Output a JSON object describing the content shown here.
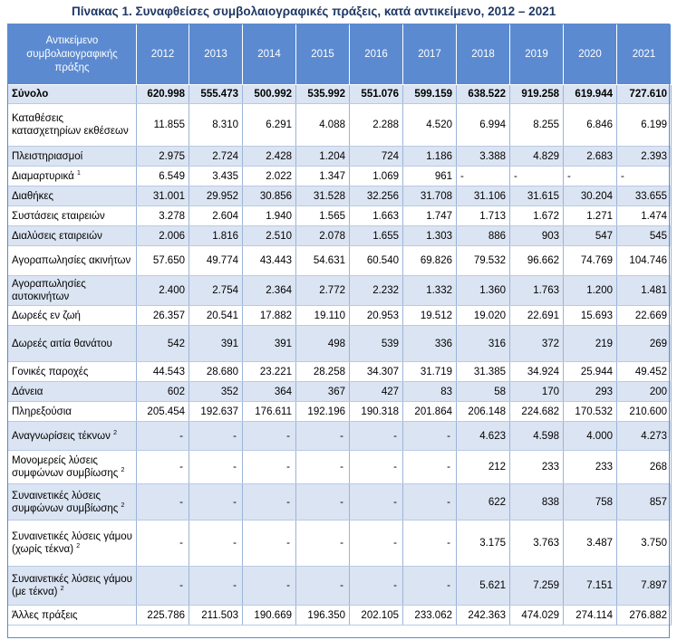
{
  "title": "Πίνακας 1. Συναφθείσες συμβολαιογραφικές πράξεις, κατά αντικείμενο, 2012 – 2021",
  "header": {
    "category": "Αντικείμενο συμβολαιογραφικής πράξης",
    "years": [
      "2012",
      "2013",
      "2014",
      "2015",
      "2016",
      "2017",
      "2018",
      "2019",
      "2020",
      "2021"
    ]
  },
  "rows": [
    {
      "label": "Σύνολο",
      "sup": "",
      "values": [
        "620.998",
        "555.473",
        "500.992",
        "535.992",
        "551.076",
        "599.159",
        "638.522",
        "919.258",
        "619.944",
        "727.610"
      ]
    },
    {
      "label": "Καταθέσεις κατασχετηρίων εκθέσεων",
      "sup": "",
      "values": [
        "11.855",
        "8.310",
        "6.291",
        "4.088",
        "2.288",
        "4.520",
        "6.994",
        "8.255",
        "6.846",
        "6.199"
      ]
    },
    {
      "label": "Πλειστηριασμοί",
      "sup": "",
      "values": [
        "2.975",
        "2.724",
        "2.428",
        "1.204",
        "724",
        "1.186",
        "3.388",
        "4.829",
        "2.683",
        "2.393"
      ]
    },
    {
      "label": "Διαμαρτυρικά",
      "sup": "1",
      "values": [
        "6.549",
        "3.435",
        "2.022",
        "1.347",
        "1.069",
        "961",
        "-",
        "-",
        "-",
        "-"
      ]
    },
    {
      "label": "Διαθήκες",
      "sup": "",
      "values": [
        "31.001",
        "29.952",
        "30.856",
        "31.528",
        "32.256",
        "31.708",
        "31.106",
        "31.615",
        "30.204",
        "33.655"
      ]
    },
    {
      "label": "Συστάσεις εταιρειών",
      "sup": "",
      "values": [
        "3.278",
        "2.604",
        "1.940",
        "1.565",
        "1.663",
        "1.747",
        "1.713",
        "1.672",
        "1.271",
        "1.474"
      ]
    },
    {
      "label": "Διαλύσεις εταιρειών",
      "sup": "",
      "values": [
        "2.006",
        "1.816",
        "2.510",
        "2.078",
        "1.655",
        "1.303",
        "886",
        "903",
        "547",
        "545"
      ]
    },
    {
      "label": "Αγοραπωλησίες ακινήτων",
      "sup": "",
      "values": [
        "57.650",
        "49.774",
        "43.443",
        "54.631",
        "60.540",
        "69.826",
        "79.532",
        "96.662",
        "74.769",
        "104.746"
      ]
    },
    {
      "label": "Αγοραπωλησίες αυτοκινήτων",
      "sup": "",
      "values": [
        "2.400",
        "2.754",
        "2.364",
        "2.772",
        "2.232",
        "1.332",
        "1.360",
        "1.763",
        "1.200",
        "1.481"
      ]
    },
    {
      "label": "Δωρεές εν ζωή",
      "sup": "",
      "values": [
        "26.357",
        "20.541",
        "17.882",
        "19.110",
        "20.953",
        "19.512",
        "19.020",
        "22.691",
        "15.693",
        "22.669"
      ]
    },
    {
      "label": "Δωρεές αιτία θανάτου",
      "sup": "",
      "values": [
        "542",
        "391",
        "391",
        "498",
        "539",
        "336",
        "316",
        "372",
        "219",
        "269"
      ]
    },
    {
      "label": "Γονικές παροχές",
      "sup": "",
      "values": [
        "44.543",
        "28.680",
        "23.221",
        "28.258",
        "34.307",
        "31.719",
        "31.385",
        "34.924",
        "25.944",
        "49.452"
      ]
    },
    {
      "label": "Δάνεια",
      "sup": "",
      "values": [
        "602",
        "352",
        "364",
        "367",
        "427",
        "83",
        "58",
        "170",
        "293",
        "200"
      ]
    },
    {
      "label": "Πληρεξούσια",
      "sup": "",
      "values": [
        "205.454",
        "192.637",
        "176.611",
        "192.196",
        "190.318",
        "201.864",
        "206.148",
        "224.682",
        "170.532",
        "210.600"
      ]
    },
    {
      "label": "Αναγνωρίσεις τέκνων",
      "sup": "2",
      "values": [
        "-",
        "-",
        "-",
        "-",
        "-",
        "-",
        "4.623",
        "4.598",
        "4.000",
        "4.273"
      ]
    },
    {
      "label": "Μονομερείς λύσεις συμφώνων συμβίωσης",
      "sup": "2",
      "values": [
        "-",
        "-",
        "-",
        "-",
        "-",
        "-",
        "212",
        "233",
        "233",
        "268"
      ]
    },
    {
      "label": "Συναινετικές λύσεις συμφώνων συμβίωσης",
      "sup": "2",
      "values": [
        "-",
        "-",
        "-",
        "-",
        "-",
        "-",
        "622",
        "838",
        "758",
        "857"
      ]
    },
    {
      "label": "Συναινετικές λύσεις γάμου (χωρίς τέκνα)",
      "sup": "2",
      "values": [
        "-",
        "-",
        "-",
        "-",
        "-",
        "-",
        "3.175",
        "3.763",
        "3.487",
        "3.750"
      ]
    },
    {
      "label": "Συναινετικές λύσεις γάμου (με τέκνα)",
      "sup": "2",
      "values": [
        "-",
        "-",
        "-",
        "-",
        "-",
        "-",
        "5.621",
        "7.259",
        "7.151",
        "7.897"
      ]
    },
    {
      "label": "Άλλες πράξεις",
      "sup": "",
      "values": [
        "225.786",
        "211.503",
        "190.669",
        "196.350",
        "202.105",
        "233.062",
        "242.363",
        "474.029",
        "274.114",
        "276.882"
      ]
    }
  ]
}
